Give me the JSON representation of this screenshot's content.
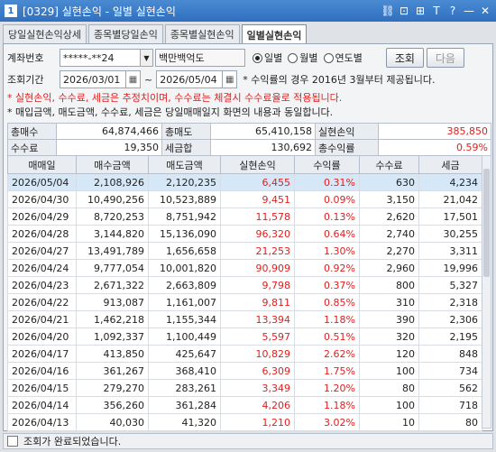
{
  "window": {
    "number": "1",
    "title": "[0329] 실현손익 - 일별 실현손익"
  },
  "tabs": [
    {
      "label": "당일실현손익상세",
      "active": false
    },
    {
      "label": "종목별당일손익",
      "active": false
    },
    {
      "label": "종목별실현손익",
      "active": false
    },
    {
      "label": "일별실현손익",
      "active": true
    }
  ],
  "form": {
    "account_label": "계좌번호",
    "account_value": "*****-**24",
    "account_name": "백만백억도",
    "period_label": "조회기간",
    "start_date": "2026/03/01",
    "date_sep": "~",
    "end_date": "2026/05/04",
    "period_note": "* 수익률의 경우 2016년 3월부터 제공됩니다.",
    "radios": [
      {
        "label": "일별",
        "checked": true
      },
      {
        "label": "월별",
        "checked": false
      },
      {
        "label": "연도별",
        "checked": false
      }
    ],
    "search_label": "조회",
    "next_label": "다음"
  },
  "notes": {
    "red": "* 실현손익, 수수료, 세금은 추정치이며, 수수료는 체결시 수수료율로 적용됩니다.",
    "black": "* 매입금액, 매도금액, 수수료, 세금은 당일매매일지 화면의 내용과 동일합니다."
  },
  "summary": {
    "total_buy_label": "총매수",
    "total_buy": "64,874,466",
    "total_sell_label": "총매도",
    "total_sell": "65,410,158",
    "realized_label": "실현손익",
    "realized": "385,850",
    "fee_label": "수수료",
    "fee": "19,350",
    "tax_label": "세금합",
    "tax": "130,692",
    "return_label": "총수익률",
    "return": "0.59%"
  },
  "columns": [
    "매매일",
    "매수금액",
    "매도금액",
    "실현손익",
    "수익률",
    "수수료",
    "세금"
  ],
  "rows": [
    [
      "2026/05/04",
      "2,108,926",
      "2,120,235",
      "6,455",
      "0.31%",
      "630",
      "4,234"
    ],
    [
      "2026/04/30",
      "10,490,256",
      "10,523,889",
      "9,451",
      "0.09%",
      "3,150",
      "21,042"
    ],
    [
      "2026/04/29",
      "8,720,253",
      "8,751,942",
      "11,578",
      "0.13%",
      "2,620",
      "17,501"
    ],
    [
      "2026/04/28",
      "3,144,820",
      "15,136,090",
      "96,320",
      "0.64%",
      "2,740",
      "30,255"
    ],
    [
      "2026/04/27",
      "13,491,789",
      "1,656,658",
      "21,253",
      "1.30%",
      "2,270",
      "3,311"
    ],
    [
      "2026/04/24",
      "9,777,054",
      "10,001,820",
      "90,909",
      "0.92%",
      "2,960",
      "19,996"
    ],
    [
      "2026/04/23",
      "2,671,322",
      "2,663,809",
      "9,798",
      "0.37%",
      "800",
      "5,327"
    ],
    [
      "2026/04/22",
      "913,087",
      "1,161,007",
      "9,811",
      "0.85%",
      "310",
      "2,318"
    ],
    [
      "2026/04/21",
      "1,462,218",
      "1,155,344",
      "13,394",
      "1.18%",
      "390",
      "2,306"
    ],
    [
      "2026/04/20",
      "1,092,337",
      "1,100,449",
      "5,597",
      "0.51%",
      "320",
      "2,195"
    ],
    [
      "2026/04/17",
      "413,850",
      "425,647",
      "10,829",
      "2.62%",
      "120",
      "848"
    ],
    [
      "2026/04/16",
      "361,267",
      "368,410",
      "6,309",
      "1.75%",
      "100",
      "734"
    ],
    [
      "2026/04/15",
      "279,270",
      "283,261",
      "3,349",
      "1.20%",
      "80",
      "562"
    ],
    [
      "2026/04/14",
      "356,260",
      "361,284",
      "4,206",
      "1.18%",
      "100",
      "718"
    ],
    [
      "2026/04/13",
      "40,030",
      "41,320",
      "1,210",
      "3.02%",
      "10",
      "80"
    ]
  ],
  "colors": {
    "positive": "#e02020",
    "title_bar": "#2f6fbf",
    "selected_row": "#d6e8f7"
  },
  "status_text": "조회가 완료되었습니다."
}
